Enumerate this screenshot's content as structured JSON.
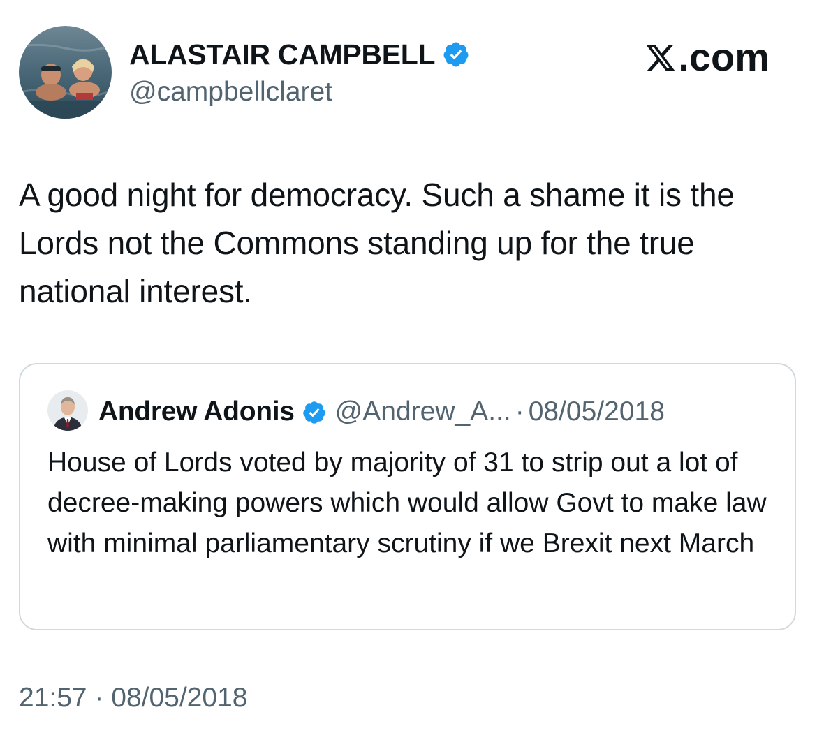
{
  "author": {
    "name": "ALASTAIR CAMPBELL",
    "handle": "@campbellclaret",
    "verified": true,
    "avatar_icon": "profile-photo-swimming"
  },
  "brand": {
    "label": ".com",
    "icon": "x-logo-icon"
  },
  "tweet": {
    "text": "A good night for democracy. Such a shame it is the Lords not the Commons standing up for the true national interest.",
    "timestamp": "21:57 · 08/05/2018"
  },
  "quoted_tweet": {
    "name": "Andrew Adonis",
    "verified": true,
    "handle": "@Andrew_A...",
    "separator": "·",
    "date": "08/05/2018",
    "text": "House of Lords voted by majority of 31 to strip out a lot of decree-making powers which would allow Govt to make law with minimal parliamentary scrutiny if we Brexit next March",
    "avatar_icon": "profile-photo-suit"
  },
  "colors": {
    "text_primary": "#0f1419",
    "text_secondary": "#536471",
    "verified_blue": "#1d9bf0",
    "card_border": "#cfd9de"
  }
}
